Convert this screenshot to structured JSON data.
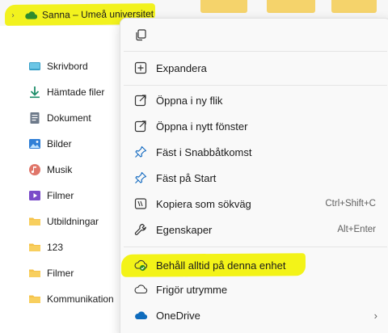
{
  "tree_header": {
    "chevron": "›",
    "label": "Sanna – Umeå universitet"
  },
  "nav": {
    "items": [
      {
        "label": "Skrivbord",
        "icon": "desktop-icon"
      },
      {
        "label": "Hämtade filer",
        "icon": "download-icon"
      },
      {
        "label": "Dokument",
        "icon": "document-icon"
      },
      {
        "label": "Bilder",
        "icon": "pictures-icon"
      },
      {
        "label": "Musik",
        "icon": "music-icon"
      },
      {
        "label": "Filmer",
        "icon": "videos-icon"
      },
      {
        "label": "Utbildningar",
        "icon": "folder-icon"
      },
      {
        "label": "123",
        "icon": "folder-icon"
      },
      {
        "label": "Filmer",
        "icon": "folder-icon"
      },
      {
        "label": "Kommunikation",
        "icon": "folder-icon"
      }
    ]
  },
  "menu": {
    "items": [
      {
        "label": "Expandera",
        "shortcut": "",
        "icon": "expand-icon"
      },
      {
        "label": "Öppna i ny flik",
        "shortcut": "",
        "icon": "open-new-tab-icon"
      },
      {
        "label": "Öppna i nytt fönster",
        "shortcut": "",
        "icon": "open-new-window-icon"
      },
      {
        "label": "Fäst i Snabbåtkomst",
        "shortcut": "",
        "icon": "pin-icon"
      },
      {
        "label": "Fäst på Start",
        "shortcut": "",
        "icon": "pin-start-icon"
      },
      {
        "label": "Kopiera som sökväg",
        "shortcut": "Ctrl+Shift+C",
        "icon": "copy-path-icon"
      },
      {
        "label": "Egenskaper",
        "shortcut": "Alt+Enter",
        "icon": "wrench-icon"
      },
      {
        "label": "Behåll alltid på denna enhet",
        "shortcut": "",
        "icon": "cloud-check-icon"
      },
      {
        "label": "Frigör utrymme",
        "shortcut": "",
        "icon": "cloud-outline-icon"
      },
      {
        "label": "OneDrive",
        "shortcut": "",
        "icon": "onedrive-icon",
        "submenu_arrow": "›"
      }
    ]
  },
  "colors": {
    "highlight": "#f3f318",
    "folder": "#f5c24a",
    "onedrive_blue": "#0f6cbd",
    "accent_green": "#2f8a1e"
  }
}
